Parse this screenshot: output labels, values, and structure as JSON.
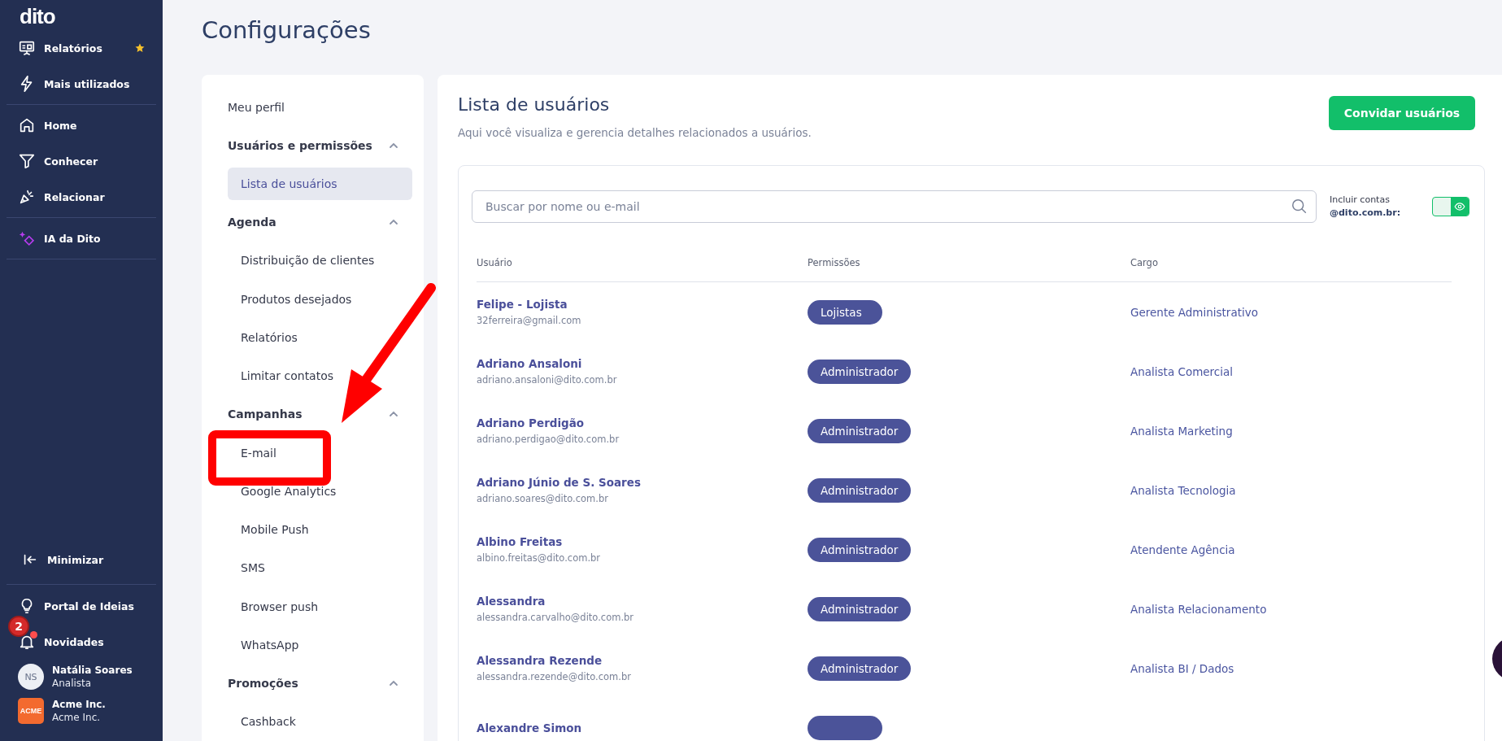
{
  "sidebar": {
    "logo": "dito",
    "groups": [
      [
        {
          "label": "Relatórios",
          "starred": true
        },
        {
          "label": "Mais utilizados",
          "starred": false
        }
      ],
      [
        {
          "label": "Home",
          "starred": false
        },
        {
          "label": "Conhecer",
          "starred": false
        },
        {
          "label": "Relacionar",
          "starred": false
        }
      ],
      [
        {
          "label": "IA da Dito",
          "starred": false
        }
      ]
    ],
    "minimize": "Minimizar",
    "footer": [
      {
        "label": "Portal de Ideias"
      },
      {
        "label": "Novidades",
        "badge": "2",
        "dot": true
      }
    ],
    "user": {
      "initials": "NS",
      "name": "Natália Soares",
      "role": "Analista"
    },
    "company": {
      "logo_text": "ACME",
      "name": "Acme Inc.",
      "subtitle": "Acme Inc."
    }
  },
  "page_title": "Configurações",
  "menu": [
    {
      "kind": "link",
      "label": "Meu perfil"
    },
    {
      "kind": "section",
      "label": "Usuários e permissões",
      "expanded": true,
      "children": [
        {
          "label": "Lista de usuários",
          "selected": true
        }
      ]
    },
    {
      "kind": "section",
      "label": "Agenda",
      "expanded": true,
      "children": [
        {
          "label": "Distribuição de clientes",
          "selected": false
        },
        {
          "label": "Produtos desejados",
          "selected": false
        },
        {
          "label": "Relatórios",
          "selected": false
        },
        {
          "label": "Limitar contatos",
          "selected": false
        }
      ]
    },
    {
      "kind": "section",
      "label": "Campanhas",
      "expanded": true,
      "children": [
        {
          "label": "E-mail",
          "selected": false
        },
        {
          "label": "Google Analytics",
          "selected": false
        },
        {
          "label": "Mobile Push",
          "selected": false
        },
        {
          "label": "SMS",
          "selected": false
        },
        {
          "label": "Browser push",
          "selected": false
        },
        {
          "label": "WhatsApp",
          "selected": false
        }
      ]
    },
    {
      "kind": "section",
      "label": "Promoções",
      "expanded": true,
      "children": [
        {
          "label": "Cashback",
          "selected": false
        }
      ]
    }
  ],
  "panel": {
    "title": "Lista de usuários",
    "subtitle": "Aqui você visualiza e gerencia detalhes relacionados a usuários.",
    "invite_button": "Convidar usuários",
    "search": {
      "placeholder": "Buscar por nome ou e-mail"
    },
    "toggle": {
      "label": "Incluir contas",
      "domain": "@dito.com.br:",
      "on": true
    },
    "table": {
      "columns": [
        "Usuário",
        "Permissões",
        "Cargo"
      ],
      "rows": [
        {
          "name": "Felipe - Lojista",
          "email": "32ferreira@gmail.com",
          "permission": "Lojistas",
          "role": "Gerente Administrativo"
        },
        {
          "name": "Adriano Ansaloni",
          "email": "adriano.ansaloni@dito.com.br",
          "permission": "Administrador",
          "role": "Analista Comercial"
        },
        {
          "name": "Adriano Perdigão",
          "email": "adriano.perdigao@dito.com.br",
          "permission": "Administrador",
          "role": "Analista Marketing"
        },
        {
          "name": "Adriano Júnio de S. Soares",
          "email": "adriano.soares@dito.com.br",
          "permission": "Administrador",
          "role": "Analista Tecnologia"
        },
        {
          "name": "Albino Freitas",
          "email": "albino.freitas@dito.com.br",
          "permission": "Administrador",
          "role": "Atendente Agência"
        },
        {
          "name": "Alessandra",
          "email": "alessandra.carvalho@dito.com.br",
          "permission": "Administrador",
          "role": "Analista Relacionamento"
        },
        {
          "name": "Alessandra Rezende",
          "email": "alessandra.rezende@dito.com.br",
          "permission": "Administrador",
          "role": "Analista BI / Dados"
        },
        {
          "name": "Alexandre Simon"
        }
      ]
    }
  }
}
